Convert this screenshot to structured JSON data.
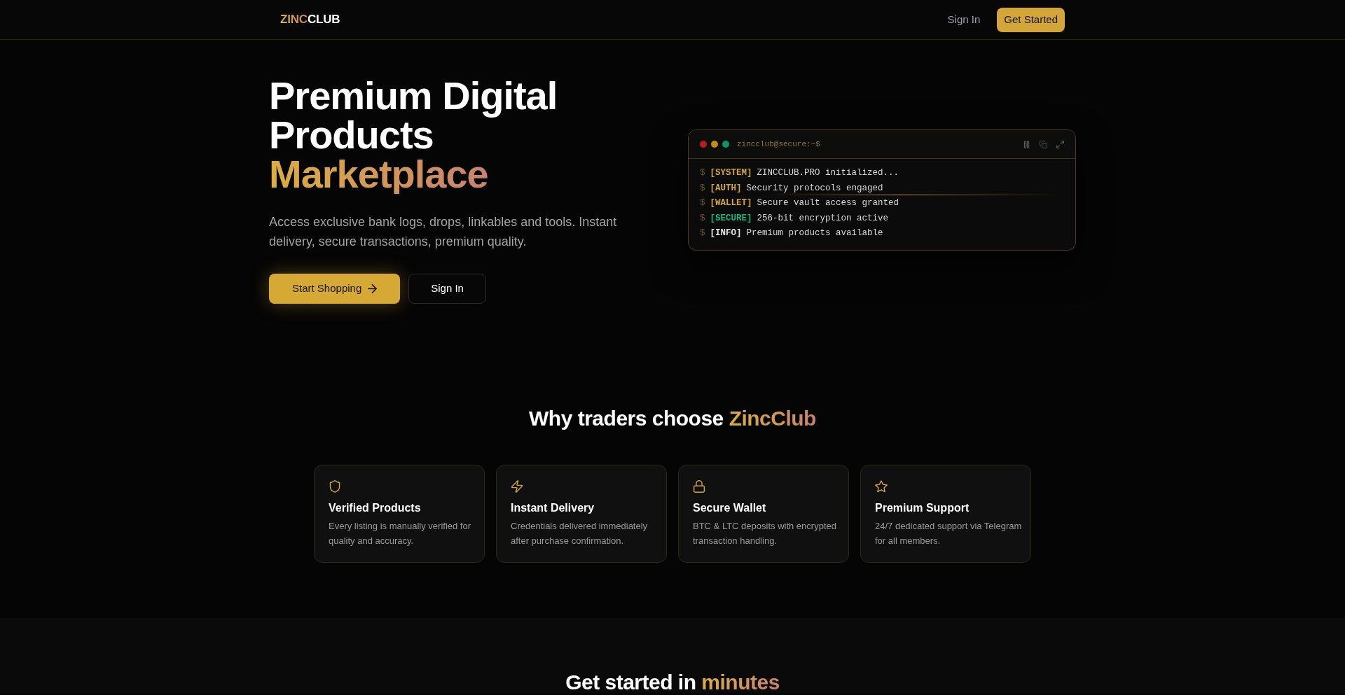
{
  "navbar": {
    "logo_highlight": "ZINC",
    "logo_rest": "CLUB",
    "sign_in": "Sign In",
    "cta": "Get Started"
  },
  "hero": {
    "title": "Premium Digital Products",
    "title_highlight": "Marketplace",
    "subtitle": "Access exclusive bank logs, drops, linkables and tools. Instant delivery, secure transactions, premium quality.",
    "buttons": [
      {
        "label": "Start Shopping",
        "kind": "primary"
      },
      {
        "label": "Sign In",
        "kind": "secondary"
      }
    ]
  },
  "terminal": {
    "title": "zincclub@secure:~$",
    "lines": [
      {
        "prompt": "$",
        "tag": "[SYSTEM]",
        "text": "ZINCCLUB.PRO initialized...",
        "color": "#d4a53a",
        "scan_line": false
      },
      {
        "prompt": "$",
        "tag": "[AUTH]",
        "text": "Security protocols engaged",
        "color": "#d4a53a",
        "scan_line": true
      },
      {
        "prompt": "$",
        "tag": "[WALLET]",
        "text": "Secure vault access granted",
        "color": "#d4a53a",
        "scan_line": false
      },
      {
        "prompt": "$",
        "tag": "[SECURE]",
        "text": "256-bit encryption active",
        "color": "#10b981",
        "scan_line": false
      },
      {
        "prompt": "$",
        "tag": "[INFO]",
        "text": "Premium products available",
        "color": "#e5e5e5",
        "scan_line": false
      }
    ]
  },
  "features": {
    "title": "Why traders choose",
    "title_highlight": "ZincClub",
    "items": [
      {
        "title": "Verified Products",
        "description": "Every listing is manually verified for quality and accuracy."
      },
      {
        "title": "Instant Delivery",
        "description": "Credentials delivered immediately after purchase confirmation."
      },
      {
        "title": "Secure Wallet",
        "description": "BTC & LTC deposits with encrypted transaction handling."
      },
      {
        "title": "Premium Support",
        "description": "24/7 dedicated support via Telegram for all members."
      }
    ]
  },
  "steps": {
    "title": "Get started in",
    "title_highlight": "minutes"
  }
}
